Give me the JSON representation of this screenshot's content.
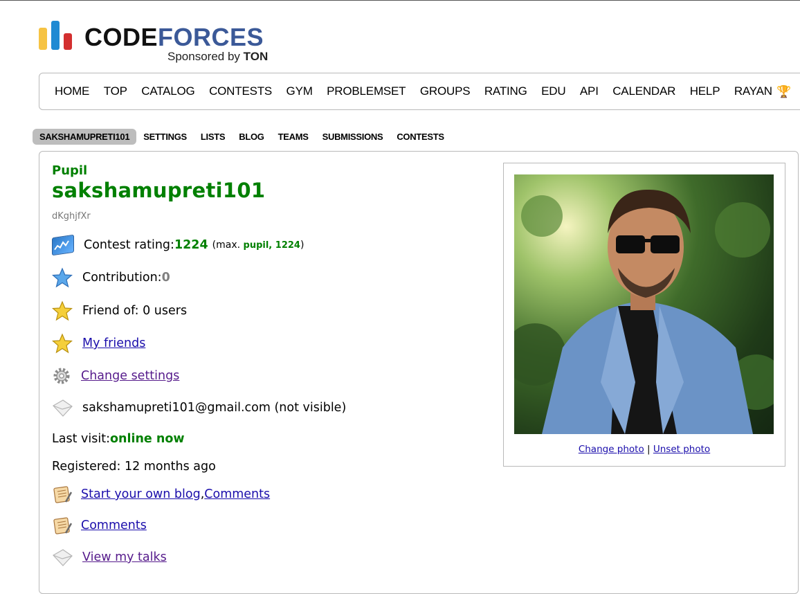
{
  "logo": {
    "word_part1": "CODE",
    "word_part2": "FORCES",
    "sponsored_prefix": "Sponsored by ",
    "sponsor": "TON",
    "colors": {
      "yellow": "#f6c343",
      "blue": "#1f8ad3",
      "red": "#d32f2f",
      "forces": "#3b5998"
    }
  },
  "menu": {
    "items": [
      "HOME",
      "TOP",
      "CATALOG",
      "CONTESTS",
      "GYM",
      "PROBLEMSET",
      "GROUPS",
      "RATING",
      "EDU",
      "API",
      "CALENDAR",
      "HELP",
      "RAYAN"
    ],
    "rayan_icon": "trophy-icon"
  },
  "subtabs": {
    "items": [
      "SAKSHAMUPRETI101",
      "SETTINGS",
      "LISTS",
      "BLOG",
      "TEAMS",
      "SUBMISSIONS",
      "CONTESTS"
    ],
    "active": "SAKSHAMUPRETI101"
  },
  "profile": {
    "rank": "Pupil",
    "handle": "sakshamupreti101",
    "real_name": "dKghjfXr",
    "contest_rating_label": "Contest rating: ",
    "contest_rating": "1224",
    "max_prefix": "(max. ",
    "max_rank": "pupil, 1224",
    "max_suffix": ")",
    "contribution_label": "Contribution: ",
    "contribution": "0",
    "friend_of": "Friend of: 0 users",
    "my_friends": "My friends",
    "change_settings": "Change settings",
    "email": "sakshamupreti101@gmail.com (not visible)",
    "last_visit_label": "Last visit: ",
    "last_visit": "online now",
    "registered": "Registered: 12 months ago",
    "start_blog": "Start your own blog",
    "comma": ", ",
    "comments_1": "Comments",
    "comments_2": "Comments",
    "view_talks": "View my talks",
    "rank_color": "#008000"
  },
  "photo": {
    "change": "Change photo",
    "separator": " | ",
    "unset": "Unset photo"
  }
}
